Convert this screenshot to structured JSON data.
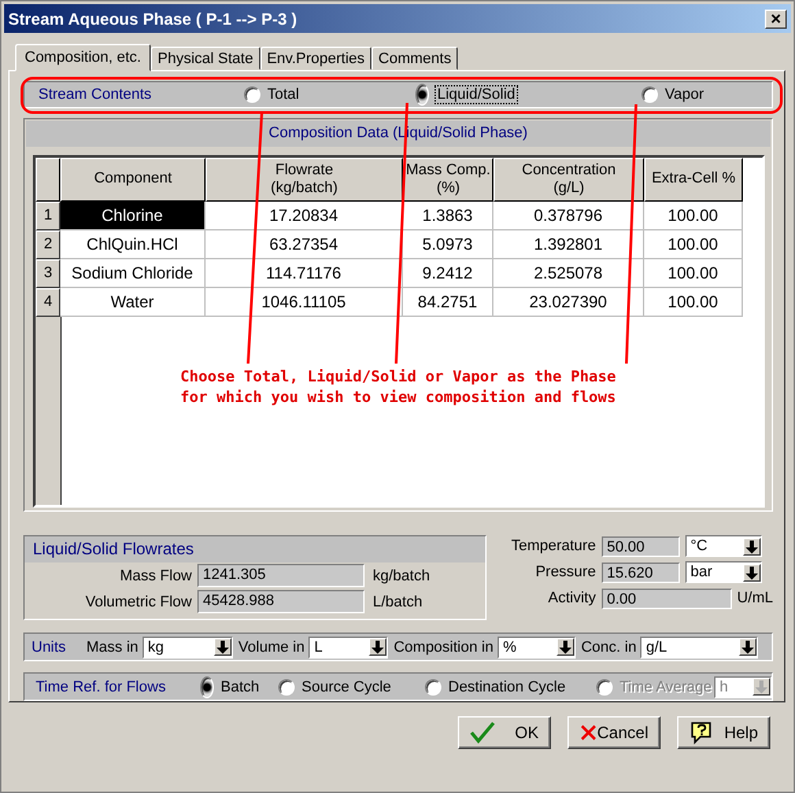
{
  "window": {
    "title": "Stream Aqueous Phase ( P-1 --> P-3 )",
    "close": "×"
  },
  "tabs": [
    {
      "label": "Composition, etc.",
      "selected": true
    },
    {
      "label": "Physical State",
      "selected": false
    },
    {
      "label": "Env.Properties",
      "selected": false
    },
    {
      "label": "Comments",
      "selected": false
    }
  ],
  "stream_contents": {
    "label": "Stream Contents",
    "options": [
      {
        "label": "Total",
        "selected": false
      },
      {
        "label": "Liquid/Solid",
        "selected": true
      },
      {
        "label": "Vapor",
        "selected": false
      }
    ]
  },
  "composition": {
    "title": "Composition Data (Liquid/Solid Phase)",
    "columns": [
      "Component",
      "Flowrate\n(kg/batch)",
      "Mass Comp.\n(%)",
      "Concentration\n(g/L)",
      "Extra-Cell %"
    ],
    "rows": [
      {
        "index": "1",
        "selected": true,
        "cells": [
          "Chlorine",
          "17.20834",
          "1.3863",
          "0.378796",
          "100.00"
        ]
      },
      {
        "index": "2",
        "selected": false,
        "cells": [
          "ChlQuin.HCl",
          "63.27354",
          "5.0973",
          "1.392801",
          "100.00"
        ]
      },
      {
        "index": "3",
        "selected": false,
        "cells": [
          "Sodium Chloride",
          "114.71176",
          "9.2412",
          "2.525078",
          "100.00"
        ]
      },
      {
        "index": "4",
        "selected": false,
        "cells": [
          "Water",
          "1046.11105",
          "84.2751",
          "23.027390",
          "100.00"
        ]
      }
    ]
  },
  "annotation": [
    "Choose Total, Liquid/Solid or Vapor as the Phase",
    "for which you wish to view composition and flows"
  ],
  "flowrates": {
    "title": "Liquid/Solid Flowrates",
    "rows": [
      {
        "label": "Mass Flow",
        "value": "1241.305",
        "unit": "kg/batch"
      },
      {
        "label": "Volumetric Flow",
        "value": "45428.988",
        "unit": "L/batch"
      }
    ]
  },
  "conditions": [
    {
      "label": "Temperature",
      "value": "50.00",
      "kind": "select",
      "unit": "°C"
    },
    {
      "label": "Pressure",
      "value": "15.620",
      "kind": "select",
      "unit": "bar"
    },
    {
      "label": "Activity",
      "value": "0.00",
      "kind": "text",
      "unit": "U/mL"
    }
  ],
  "units": {
    "label": "Units",
    "fields": [
      {
        "label": "Mass in",
        "value": "kg"
      },
      {
        "label": "Volume in",
        "value": "L"
      },
      {
        "label": "Composition in",
        "value": "%"
      },
      {
        "label": "Conc. in",
        "value": "g/L"
      }
    ]
  },
  "time_ref": {
    "label": "Time Ref. for Flows",
    "options": [
      {
        "label": "Batch",
        "selected": true,
        "disabled": false
      },
      {
        "label": "Source Cycle",
        "selected": false,
        "disabled": false
      },
      {
        "label": "Destination Cycle",
        "selected": false,
        "disabled": false
      },
      {
        "label": "Time Average",
        "selected": false,
        "disabled": true
      }
    ],
    "unit": "h",
    "unit_disabled": true
  },
  "buttons": [
    {
      "label": "OK",
      "kind": "ok"
    },
    {
      "label": "Cancel",
      "kind": "cancel"
    },
    {
      "label": "Help",
      "kind": "help"
    }
  ]
}
